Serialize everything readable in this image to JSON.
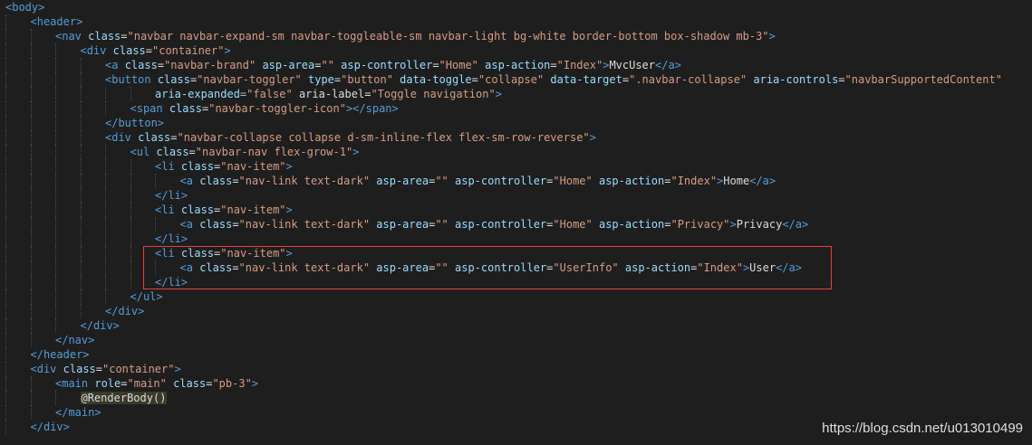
{
  "code_lines": [
    "<body>",
    "<header>",
    "<nav class=\"navbar navbar-expand-sm navbar-toggleable-sm navbar-light bg-white border-bottom box-shadow mb-3\">",
    "<div class=\"container\">",
    "<a class=\"navbar-brand\" asp-area=\"\" asp-controller=\"Home\" asp-action=\"Index\">MvcUser</a>",
    "<button class=\"navbar-toggler\" type=\"button\" data-toggle=\"collapse\" data-target=\".navbar-collapse\" aria-controls=\"navbarSupportedContent\"",
    "aria-expanded=\"false\" aria-label=\"Toggle navigation\">",
    "<span class=\"navbar-toggler-icon\"></span>",
    "</button>",
    "<div class=\"navbar-collapse collapse d-sm-inline-flex flex-sm-row-reverse\">",
    "<ul class=\"navbar-nav flex-grow-1\">",
    "<li class=\"nav-item\">",
    "<a class=\"nav-link text-dark\" asp-area=\"\" asp-controller=\"Home\" asp-action=\"Index\">Home</a>",
    "</li>",
    "<li class=\"nav-item\">",
    "<a class=\"nav-link text-dark\" asp-area=\"\" asp-controller=\"Home\" asp-action=\"Privacy\">Privacy</a>",
    "</li>",
    "<li class=\"nav-item\">",
    "<a class=\"nav-link text-dark\" asp-area=\"\" asp-controller=\"UserInfo\" asp-action=\"Index\">User</a>",
    "</li>",
    "</ul>",
    "</div>",
    "</div>",
    "</nav>",
    "</header>",
    "<div class=\"container\">",
    "<main role=\"main\" class=\"pb-3\">",
    "@RenderBody()",
    "</main>",
    "</div>"
  ],
  "watermark": "https://blog.csdn.net/u013010499",
  "colors": {
    "background": "#1e1e1e",
    "tag": "#569cd6",
    "attribute": "#9cdcfe",
    "string": "#d69d85",
    "asp_attribute": "#4ec9b0",
    "highlight_border": "#e0433a"
  }
}
